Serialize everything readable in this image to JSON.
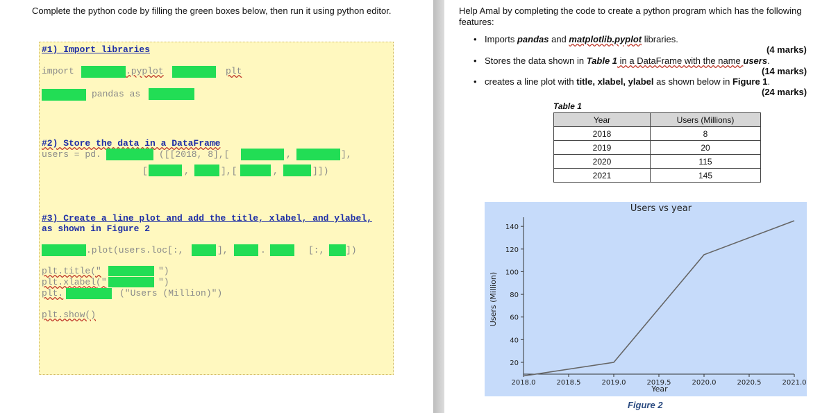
{
  "left": {
    "instruction": "Complete the python code by filling the green boxes below, then run it using python editor.",
    "code": {
      "section1_comment": "#1) Import libraries",
      "line_import": "import",
      "line_import_mid": ".pyplot",
      "line_import_end": "plt",
      "line_pandas": "pandas as",
      "section2_comment": "#2) Store the data in a DataFrame",
      "line_users": "users = pd.",
      "line_users_data": "([[2018, 8],[",
      "line_users_end": "],",
      "line_row2_end": "]])",
      "section3_comment": "#3) Create a line plot and add the title, xlabel, and ylabel,",
      "section3_comment2": "as shown in Figure 2",
      "line_plot": ".plot(users.loc[:,",
      "line_plot_mid": "],",
      "line_plot_iloc": "[:,",
      "line_plot_end": "])",
      "line_title": "plt.title(\"",
      "line_xlabel": "plt.xlabel(\"",
      "line_close": "\")",
      "line_ylabel_prefix": "plt.",
      "line_ylabel_arg": "(\"Users (Million)\")",
      "line_show": "plt.show()"
    }
  },
  "right": {
    "help_text": "Help Amal by completing the code to create a python program which has the following features:",
    "bullets": [
      {
        "text_pre": "Imports ",
        "bold1": "pandas",
        "mid": " and ",
        "bold2": "matplotlib.pyplot",
        "post": " libraries.",
        "marks": "(4 marks)"
      },
      {
        "text_pre": "Stores the data shown in ",
        "bold1": "Table 1",
        "mid": " in a DataFrame with the name ",
        "bold2": "users",
        "post": ".",
        "marks": "(14 marks)"
      },
      {
        "text_pre": "creates a line plot with ",
        "bold1": "title, xlabel, ylabel",
        "mid": " as shown below in ",
        "bold2": "Figure 1",
        "post": ".",
        "marks": "(24 marks)"
      }
    ],
    "table_caption": "Table 1",
    "table_headers": [
      "Year",
      "Users (Millions)"
    ],
    "table_rows": [
      [
        "2018",
        "8"
      ],
      [
        "2019",
        "20"
      ],
      [
        "2020",
        "115"
      ],
      [
        "2021",
        "145"
      ]
    ],
    "figure_caption": "Figure 2"
  },
  "colors": {
    "fill_box": "#22dd55",
    "code_bg": "#fff8bf",
    "chart_bg": "#c6dbfa",
    "line": "#666666"
  },
  "chart_data": {
    "type": "line",
    "title": "Users vs year",
    "xlabel": "Year",
    "ylabel": "Users (Million)",
    "x": [
      2018,
      2019,
      2020,
      2021
    ],
    "series": [
      {
        "values": [
          8,
          20,
          115,
          145
        ]
      }
    ],
    "xticks": [
      "2018.0",
      "2018.5",
      "2019.0",
      "2019.5",
      "2020.0",
      "2020.5",
      "2021.0"
    ],
    "yticks": [
      "20",
      "40",
      "60",
      "80",
      "100",
      "120",
      "140"
    ],
    "xlim": [
      2018,
      2021
    ],
    "ylim": [
      8,
      145
    ],
    "grid": false
  }
}
